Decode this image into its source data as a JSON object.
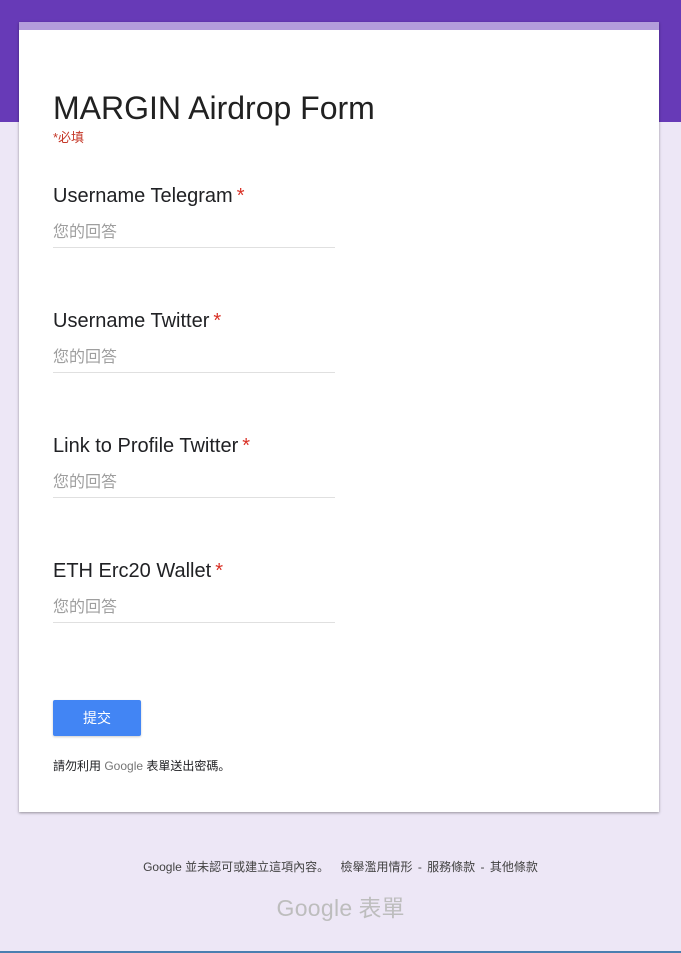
{
  "colors": {
    "theme": "#673ab7",
    "accent": "#b39ddb",
    "background": "#ede7f6",
    "required": "#d93025",
    "submit": "#4285f4"
  },
  "form": {
    "title": "MARGIN Airdrop Form",
    "required_note": "*必填",
    "questions": [
      {
        "label": "Username Telegram",
        "required_mark": "*",
        "placeholder": "您的回答",
        "value": ""
      },
      {
        "label": "Username Twitter",
        "required_mark": "*",
        "placeholder": "您的回答",
        "value": ""
      },
      {
        "label": "Link to Profile Twitter",
        "required_mark": "*",
        "placeholder": "您的回答",
        "value": ""
      },
      {
        "label": "ETH Erc20 Wallet",
        "required_mark": "*",
        "placeholder": "您的回答",
        "value": ""
      }
    ],
    "submit_label": "提交",
    "password_warning": {
      "prefix": "請勿利用 ",
      "google": "Google",
      "suffix": " 表單送出密碼。"
    }
  },
  "footer": {
    "disclaimer": "Google 並未認可或建立這項內容。",
    "links": [
      "檢舉濫用情形",
      "服務條款",
      "其他條款"
    ],
    "separator": "-",
    "logo_brand": "Google",
    "logo_product": "表單"
  }
}
